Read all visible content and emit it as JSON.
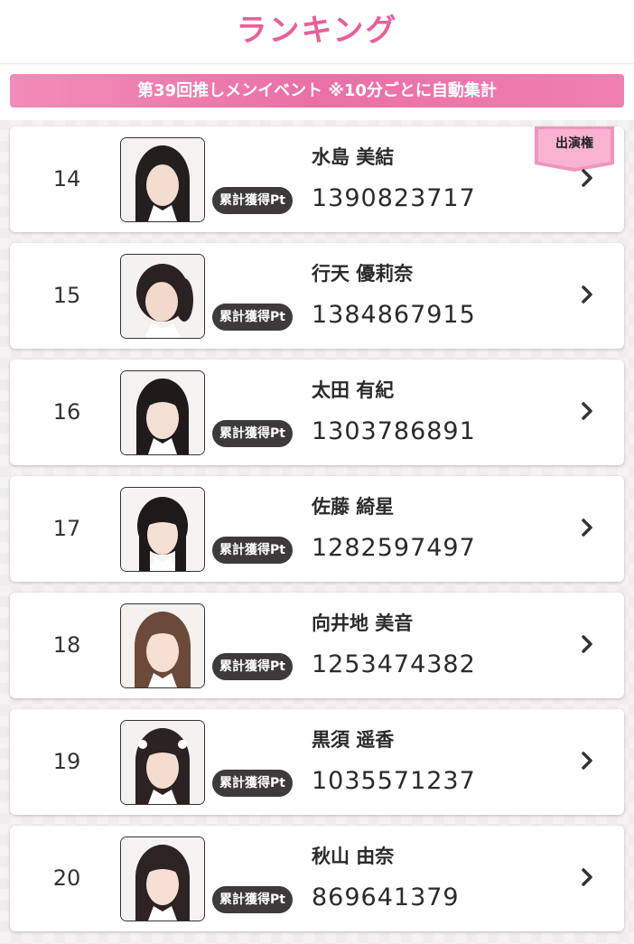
{
  "page": {
    "title": "ランキング",
    "event_banner": "第39回推しメンイベント ※10分ごとに自動集計"
  },
  "labels": {
    "points_badge": "累計獲得Pt",
    "performance_ribbon": "出演権"
  },
  "colors": {
    "accent_pink": "#e8609a",
    "banner_pink": "#ea70a6",
    "badge_dark": "#3d3a3c",
    "text_dark": "#2b2b2b"
  },
  "icons": {
    "row_arrow": "chevron-right-icon",
    "portrait": "member-photo"
  },
  "ranking": [
    {
      "rank": "14",
      "name": "水島 美結",
      "points": "1390823717",
      "has_ribbon": true
    },
    {
      "rank": "15",
      "name": "行天 優莉奈",
      "points": "1384867915",
      "has_ribbon": false
    },
    {
      "rank": "16",
      "name": "太田 有紀",
      "points": "1303786891",
      "has_ribbon": false
    },
    {
      "rank": "17",
      "name": "佐藤 綺星",
      "points": "1282597497",
      "has_ribbon": false
    },
    {
      "rank": "18",
      "name": "向井地 美音",
      "points": "1253474382",
      "has_ribbon": false
    },
    {
      "rank": "19",
      "name": "黒須 遥香",
      "points": "1035571237",
      "has_ribbon": false
    },
    {
      "rank": "20",
      "name": "秋山 由奈",
      "points": "869641379",
      "has_ribbon": false
    }
  ]
}
